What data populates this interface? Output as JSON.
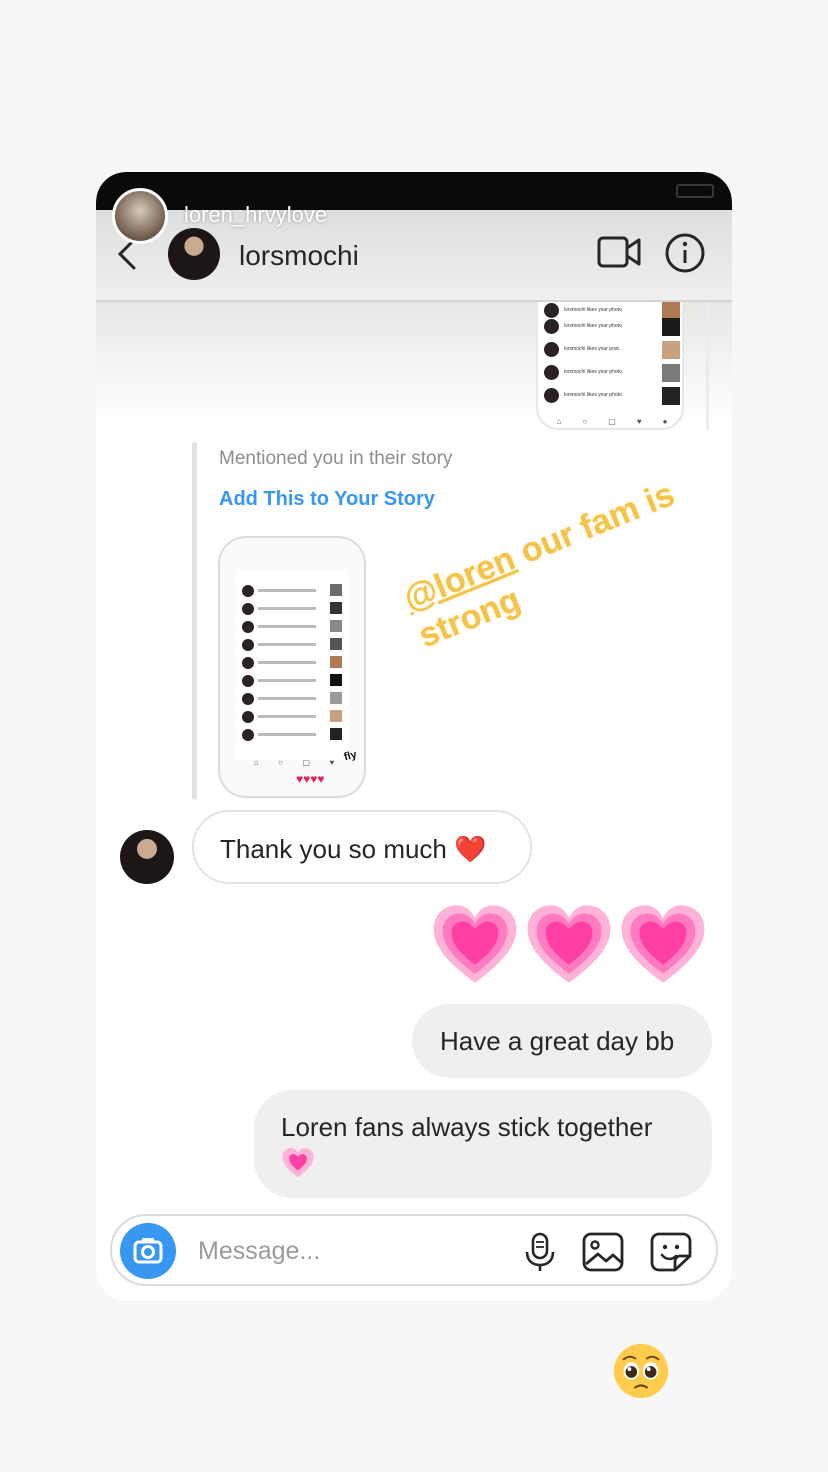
{
  "story_overlay": {
    "username": "loren_hrvylove",
    "caption_mention": "@loren",
    "caption_rest": " our fam is strong",
    "reaction_emoji_icon": "pleading-face-icon"
  },
  "header": {
    "chat_name": "lorsmochi",
    "icons": [
      "back-chevron-icon",
      "video-camera-icon",
      "info-icon"
    ]
  },
  "thread": {
    "shared_story": {
      "mention_text": "Mentioned you in their story",
      "add_story_label": "Add This to Your Story",
      "thumb_sticker": "fly",
      "thumb_hearts": "♥♥♥♥"
    },
    "preview_rows": [
      "lorsmochi likes your photo.",
      "lorsmochi likes your photo.",
      "lorsmochi likes your post.",
      "lorsmochi likes your photo.",
      "lorsmochi likes your photo."
    ],
    "incoming": {
      "text": "Thank you so much ❤️"
    },
    "outgoing_hearts_icon": "growing-heart-icon",
    "outgoing": [
      {
        "text": "Have a great day bb"
      },
      {
        "text": "Loren fans always stick together",
        "emoji_icon": "growing-heart-icon"
      }
    ]
  },
  "composer": {
    "placeholder": "Message...",
    "icons": [
      "camera-icon",
      "microphone-icon",
      "gallery-icon",
      "sticker-icon"
    ]
  },
  "colors": {
    "accent": "#3897f0",
    "caption": "#f5c24a",
    "heart_pink": "#ff3fa4",
    "bubble_out": "#efefef"
  }
}
